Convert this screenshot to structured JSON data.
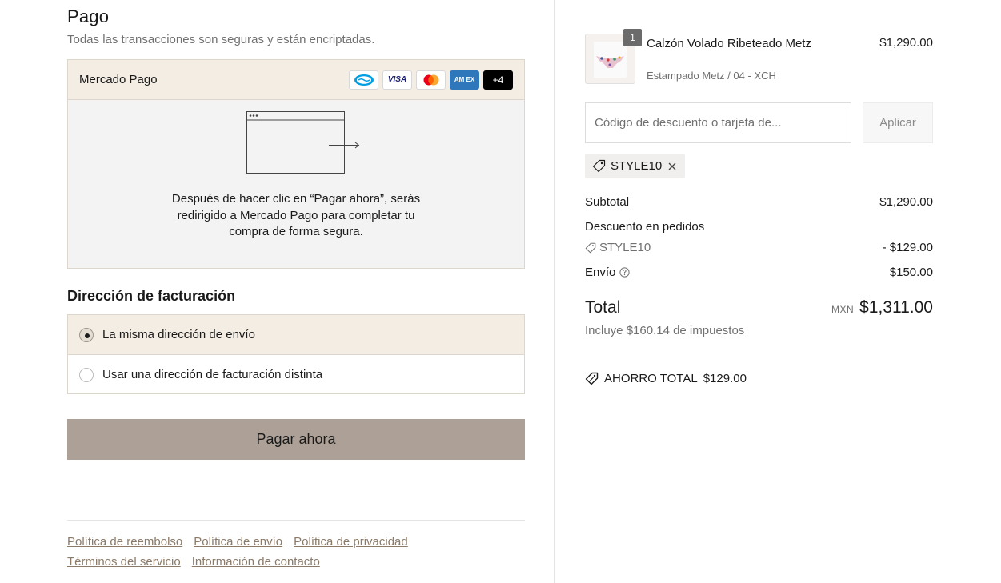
{
  "payment": {
    "title": "Pago",
    "subtitle": "Todas las transacciones son seguras y están encriptadas.",
    "method_label": "Mercado Pago",
    "card_icons": [
      "mercadopago-icon",
      "visa-icon",
      "mastercard-icon",
      "amex-icon"
    ],
    "card_visa_text": "VISA",
    "card_amex_text": "AM EX",
    "more_cards": "+4",
    "info": "Después de hacer clic en “Pagar ahora”, serás redirigido a Mercado Pago para completar tu compra de forma segura."
  },
  "billing": {
    "title": "Dirección de facturación",
    "options": [
      {
        "label": "La misma dirección de envío",
        "selected": true
      },
      {
        "label": "Usar una dirección de facturación distinta",
        "selected": false
      }
    ]
  },
  "pay_button": "Pagar ahora",
  "footer": {
    "links": [
      "Política de reembolso",
      "Política de envío",
      "Política de privacidad",
      "Términos del servicio",
      "Información de contacto"
    ]
  },
  "cart": {
    "item": {
      "quantity": "1",
      "name": "Calzón Volado Ribeteado Metz",
      "variant": "Estampado Metz / 04 - XCH",
      "price": "$1,290.00"
    },
    "discount_placeholder": "Código de descuento o tarjeta de...",
    "apply_label": "Aplicar",
    "applied_code": "STYLE10",
    "subtotal_label": "Subtotal",
    "subtotal": "$1,290.00",
    "order_discount_label": "Descuento en pedidos",
    "discount_code": "STYLE10",
    "discount_amount": "- $129.00",
    "shipping_label": "Envío",
    "shipping": "$150.00",
    "total_label": "Total",
    "currency": "MXN",
    "total": "$1,311.00",
    "taxes_note": "Incluye $160.14 de impuestos",
    "savings_label": "AHORRO TOTAL",
    "savings_amount": "$129.00"
  },
  "colors": {
    "accent_bg": "#f3ede4",
    "button": "#ada197",
    "link": "#8b7a68"
  }
}
